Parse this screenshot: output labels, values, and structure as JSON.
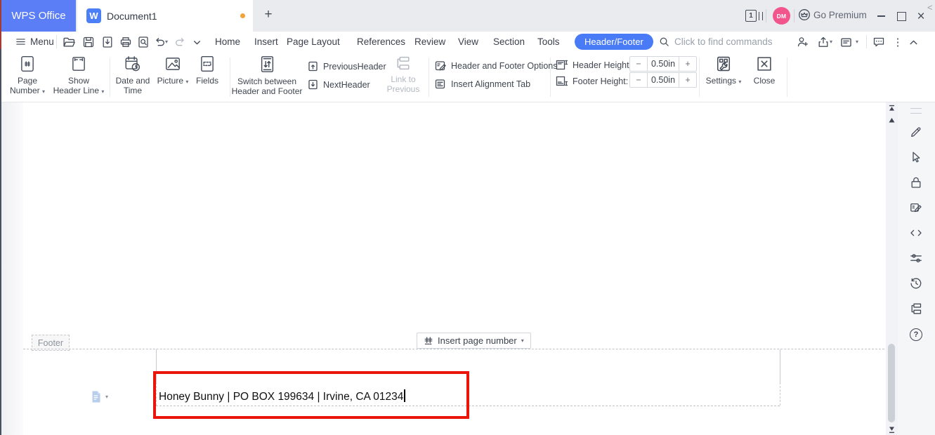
{
  "titlebar": {
    "app_button": "WPS Office",
    "document_tab": "Document1",
    "window_count": "1",
    "avatar_initials": "DM",
    "go_premium": "Go Premium"
  },
  "menubar": {
    "menu": "Menu",
    "tabs": [
      "Home",
      "Insert",
      "Page Layout",
      "References",
      "Review",
      "View",
      "Section",
      "Tools"
    ],
    "contextual_tab": "Header/Footer",
    "search_placeholder": "Click to find commands"
  },
  "ribbon": {
    "page_number_l1": "Page",
    "page_number_l2": "Number",
    "show_header_line_l1": "Show",
    "show_header_line_l2": "Header Line",
    "date_time_l1": "Date and",
    "date_time_l2": "Time",
    "picture": "Picture",
    "fields": "Fields",
    "switch_l1": "Switch between",
    "switch_l2": "Header and Footer",
    "previous_header": "PreviousHeader",
    "next_header": "NextHeader",
    "link_to_previous_l1": "Link to",
    "link_to_previous_l2": "Previous",
    "hf_options": "Header and Footer Options",
    "insert_alignment_tab": "Insert Alignment Tab",
    "header_height_label": "Header Height:",
    "header_height_value": "0.50in",
    "footer_height_label": "Footer Height:",
    "footer_height_value": "0.50in",
    "settings": "Settings",
    "close": "Close"
  },
  "document": {
    "footer_label": "Footer",
    "insert_page_number": "Insert page number",
    "footer_text": "Honey Bunny | PO BOX 199634 | Irvine, CA 01234"
  },
  "colors": {
    "accent_blue": "#4a7bf6",
    "annotation_red": "#ea1508",
    "modified_dot": "#f2a33c",
    "avatar_pink": "#f2558c"
  }
}
